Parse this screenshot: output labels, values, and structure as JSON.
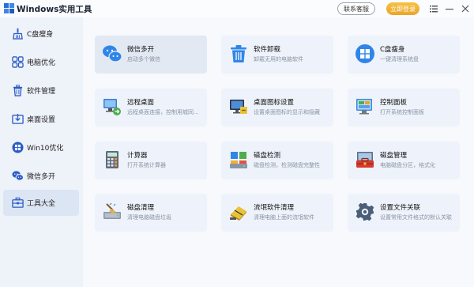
{
  "window": {
    "title": "Windows实用工具",
    "contact_button": "联系客服",
    "login_button": "立即登录"
  },
  "sidebar": {
    "items": [
      {
        "label": "C盘瘦身",
        "icon": "broom-icon",
        "active": false
      },
      {
        "label": "电脑优化",
        "icon": "grid-icon",
        "active": false
      },
      {
        "label": "软件管理",
        "icon": "trash-icon",
        "active": false
      },
      {
        "label": "桌面设置",
        "icon": "desktop-download-icon",
        "active": false
      },
      {
        "label": "Win10优化",
        "icon": "windows-icon",
        "active": false
      },
      {
        "label": "微信多开",
        "icon": "wechat-icon",
        "active": false
      },
      {
        "label": "工具大全",
        "icon": "toolbox-icon",
        "active": true
      }
    ]
  },
  "tools": [
    {
      "title": "微信多开",
      "desc": "启动多个微信",
      "icon": "wechat-icon"
    },
    {
      "title": "软件卸载",
      "desc": "卸载无用的电脑软件",
      "icon": "trash-icon"
    },
    {
      "title": "C盘瘦身",
      "desc": "一键清理系统盘",
      "icon": "windows-icon"
    },
    {
      "title": "远程桌面",
      "desc": "远程桌面连接，控制用城同...",
      "icon": "remote-desktop-icon"
    },
    {
      "title": "桌面图标设置",
      "desc": "设置桌面图标的显示和隐藏",
      "icon": "desktop-icons-icon"
    },
    {
      "title": "控制面板",
      "desc": "打开系统控制面板",
      "icon": "control-panel-icon"
    },
    {
      "title": "计算器",
      "desc": "打开系统计算器",
      "icon": "calculator-icon"
    },
    {
      "title": "磁盘检测",
      "desc": "磁盘检测，检测磁盘完整性",
      "icon": "disk-check-icon"
    },
    {
      "title": "磁盘管理",
      "desc": "电脑磁盘分区，格式化",
      "icon": "toolbox-red-icon"
    },
    {
      "title": "磁盘清理",
      "desc": "清理电脑磁盘垃圾",
      "icon": "disk-cleanup-icon"
    },
    {
      "title": "流氓软件清理",
      "desc": "清理电脑上面的流氓软件",
      "icon": "eraser-icon"
    },
    {
      "title": "设置文件关联",
      "desc": "设置常用文件格式的默认关联",
      "icon": "gear-icon"
    }
  ]
}
